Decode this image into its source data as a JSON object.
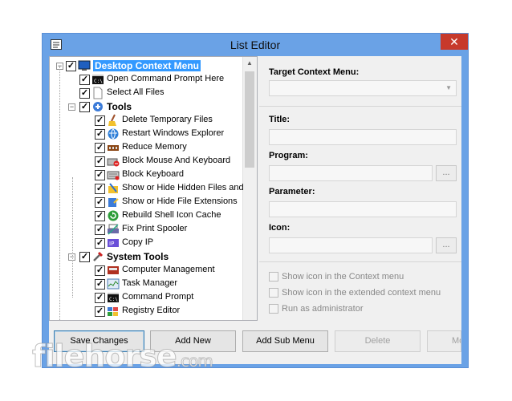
{
  "window": {
    "title": "List Editor",
    "close": "✕"
  },
  "tree": {
    "items": [
      {
        "label": "Desktop Context Menu",
        "bold": true,
        "selected": true,
        "level": 0,
        "expander": "−",
        "icon": "monitor-icon"
      },
      {
        "label": "Open Command Prompt Here",
        "level": 1,
        "icon": "cmd-icon"
      },
      {
        "label": "Select All Files",
        "level": 1,
        "icon": "file-icon"
      },
      {
        "label": "Tools",
        "bold": true,
        "level": 1,
        "expander": "−",
        "icon": "tools-icon"
      },
      {
        "label": "Delete Temporary Files",
        "level": 2,
        "icon": "broom-icon"
      },
      {
        "label": "Restart Windows Explorer",
        "level": 2,
        "icon": "globe-icon"
      },
      {
        "label": "Reduce Memory",
        "level": 2,
        "icon": "memory-icon"
      },
      {
        "label": "Block Mouse And Keyboard",
        "level": 2,
        "icon": "keyboard-block-icon"
      },
      {
        "label": "Block Keyboard",
        "level": 2,
        "icon": "keyboard-icon"
      },
      {
        "label": "Show or Hide Hidden Files and",
        "level": 2,
        "icon": "hidden-files-icon"
      },
      {
        "label": "Show or Hide File Extensions",
        "level": 2,
        "icon": "extensions-icon"
      },
      {
        "label": "Rebuild Shell Icon Cache",
        "level": 2,
        "icon": "refresh-icon"
      },
      {
        "label": "Fix Print Spooler",
        "level": 2,
        "icon": "printer-icon"
      },
      {
        "label": "Copy IP",
        "level": 2,
        "icon": "ip-icon"
      },
      {
        "label": "System Tools",
        "bold": true,
        "level": 1,
        "expander": "−",
        "icon": "system-tools-icon"
      },
      {
        "label": "Computer Management",
        "level": 2,
        "icon": "computer-management-icon"
      },
      {
        "label": "Task Manager",
        "level": 2,
        "icon": "task-manager-icon"
      },
      {
        "label": "Command Prompt",
        "level": 2,
        "icon": "cmd-icon"
      },
      {
        "label": "Registry Editor",
        "level": 2,
        "icon": "registry-icon"
      }
    ]
  },
  "panel": {
    "target_label": "Target Context Menu:",
    "title_label": "Title:",
    "program_label": "Program:",
    "parameter_label": "Parameter:",
    "icon_label": "Icon:",
    "browse": "...",
    "check_show_icon": "Show icon in the Context menu",
    "check_extended": "Show icon in the extended context menu",
    "check_admin": "Run as administrator"
  },
  "buttons": {
    "save": "Save Changes",
    "add_new": "Add New",
    "add_sub": "Add Sub Menu",
    "delete": "Delete",
    "more": "Mo"
  },
  "watermark": {
    "name": "filehorse",
    "suffix": ".com"
  },
  "colors": {
    "titlebar": "#6aa2e6",
    "close": "#c7392b",
    "selection": "#3399ff"
  }
}
